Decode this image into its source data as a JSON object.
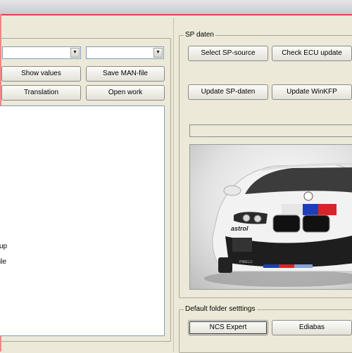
{
  "left_panel": {
    "combo1_value": "",
    "combo2_value": "",
    "show_values_label": "Show values",
    "save_man_file_label": "Save MAN-file",
    "translation_label": "Translation",
    "open_work_label": "Open work",
    "list_items": [
      "up",
      "ile"
    ]
  },
  "sp_daten": {
    "title": "SP daten",
    "select_sp_source_label": "Select SP-source",
    "check_ecu_update_label": "Check ECU update",
    "update_sp_daten_label": "Update SP-daten",
    "update_winkfp_label": "Update WinKFP",
    "progress": 0,
    "car_plate_text": "astrol"
  },
  "default_folder": {
    "title": "Default folder setttings",
    "ncs_expert_label": "NCS Expert",
    "ediabas_label": "Ediabas"
  },
  "colors": {
    "window_bg": "#ece9d8",
    "title_accent": "#dd4444",
    "m_blue": "#1c3fb8",
    "m_red": "#d8232a"
  },
  "icons": {
    "dropdown": "chevron-down-icon"
  }
}
